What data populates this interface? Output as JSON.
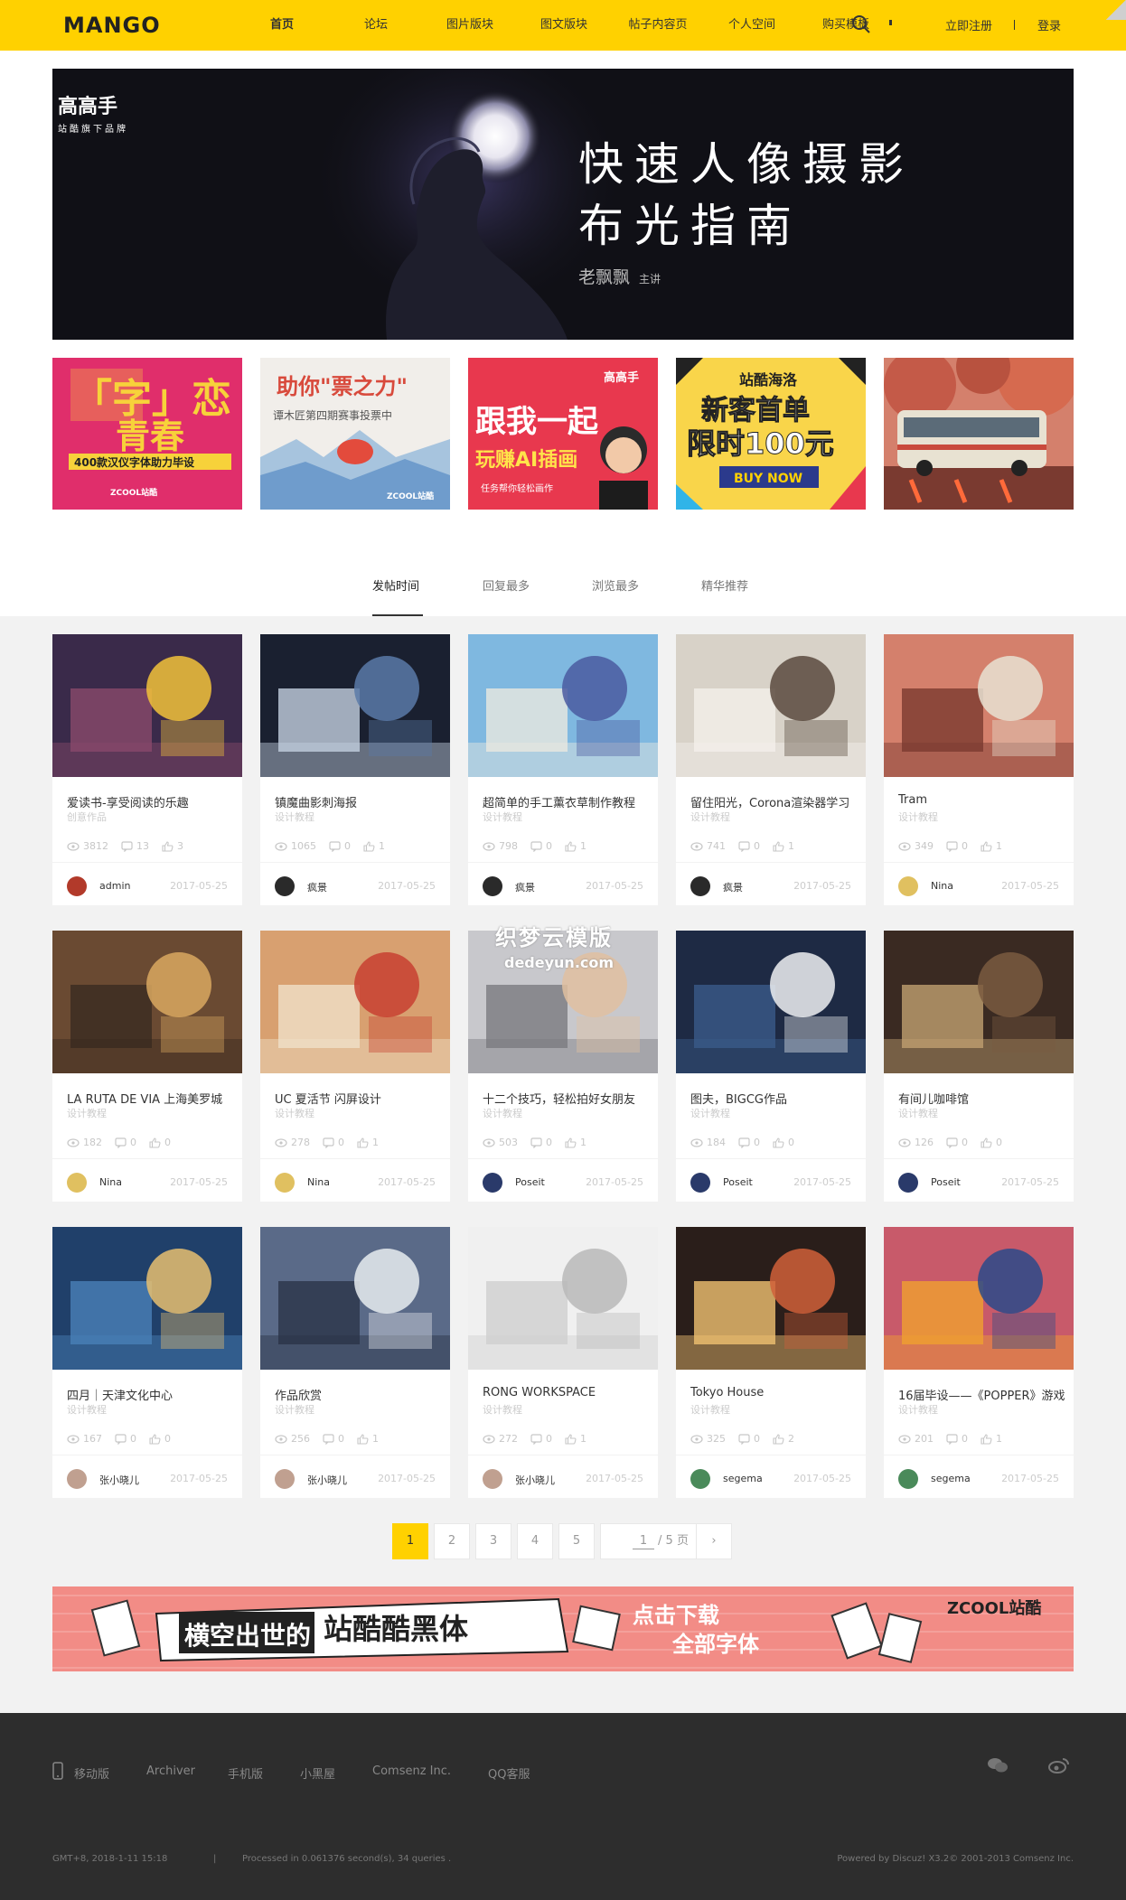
{
  "header": {
    "logo": "MANGO",
    "nav": [
      "首页",
      "论坛",
      "图片版块",
      "图文版块",
      "帖子内容页",
      "个人空间",
      "购买模板"
    ],
    "register": "立即注册",
    "login": "登录"
  },
  "hero": {
    "logo_big": "高高手",
    "logo_small": "站酷旗下品牌",
    "title_line1": "快速人像摄影",
    "title_line2": "布光指南",
    "author": "老飘飘",
    "author_role": "主讲"
  },
  "promos": [
    {
      "name": "promo-font-youth",
      "text1": "「字」恋",
      "text2": "青春",
      "text3": "400款汉仪字体助力毕设",
      "text4": "ZCOOL站酷"
    },
    {
      "name": "promo-vote",
      "text1": "助你\"票之力\"",
      "text2": "谭木匠第四期赛事投票中",
      "text3": "ZCOOL站酷"
    },
    {
      "name": "promo-ai",
      "text1": "高高手",
      "text2": "跟我一起",
      "text3": "玩赚AI插画",
      "text4": "任务帮你轻松画作"
    },
    {
      "name": "promo-shop",
      "text1": "站酷海洛",
      "text2": "新客首单",
      "text3": "限时100元",
      "text4": "BUY NOW"
    },
    {
      "name": "promo-bus",
      "text1": ""
    }
  ],
  "tabs": [
    "发帖时间",
    "回复最多",
    "浏览最多",
    "精华推荐"
  ],
  "cards": [
    {
      "title": "爱读书-享受阅读的乐趣",
      "cat": "创意作品",
      "views": "3812",
      "replies": "13",
      "likes": "3",
      "user": "admin",
      "date": "2017-05-25"
    },
    {
      "title": "镇魔曲影刺海报",
      "cat": "设计教程",
      "views": "1065",
      "replies": "0",
      "likes": "1",
      "user": "疯景",
      "date": "2017-05-25"
    },
    {
      "title": "超简单的手工薰衣草制作教程",
      "cat": "设计教程",
      "views": "798",
      "replies": "0",
      "likes": "1",
      "user": "疯景",
      "date": "2017-05-25"
    },
    {
      "title": "留住阳光，Corona渲染器学习",
      "cat": "设计教程",
      "views": "741",
      "replies": "0",
      "likes": "1",
      "user": "疯景",
      "date": "2017-05-25"
    },
    {
      "title": "Tram",
      "cat": "设计教程",
      "views": "349",
      "replies": "0",
      "likes": "1",
      "user": "Nina",
      "date": "2017-05-25"
    },
    {
      "title": "LA RUTA DE VIA 上海美罗城",
      "cat": "设计教程",
      "views": "182",
      "replies": "0",
      "likes": "0",
      "user": "Nina",
      "date": "2017-05-25"
    },
    {
      "title": "UC 夏活节 闪屏设计",
      "cat": "设计教程",
      "views": "278",
      "replies": "0",
      "likes": "1",
      "user": "Nina",
      "date": "2017-05-25"
    },
    {
      "title": "十二个技巧，轻松拍好女朋友",
      "cat": "设计教程",
      "views": "503",
      "replies": "0",
      "likes": "1",
      "user": "Poseit",
      "date": "2017-05-25"
    },
    {
      "title": "图夫，BIGCG作品",
      "cat": "设计教程",
      "views": "184",
      "replies": "0",
      "likes": "0",
      "user": "Poseit",
      "date": "2017-05-25"
    },
    {
      "title": "有间儿咖啡馆",
      "cat": "设计教程",
      "views": "126",
      "replies": "0",
      "likes": "0",
      "user": "Poseit",
      "date": "2017-05-25"
    },
    {
      "title": "四月｜天津文化中心",
      "cat": "设计教程",
      "views": "167",
      "replies": "0",
      "likes": "0",
      "user": "张小晓儿",
      "date": "2017-05-25"
    },
    {
      "title": "作品欣赏",
      "cat": "设计教程",
      "views": "256",
      "replies": "0",
      "likes": "1",
      "user": "张小晓儿",
      "date": "2017-05-25"
    },
    {
      "title": "RONG WORKSPACE",
      "cat": "设计教程",
      "views": "272",
      "replies": "0",
      "likes": "1",
      "user": "张小晓儿",
      "date": "2017-05-25"
    },
    {
      "title": "Tokyo House",
      "cat": "设计教程",
      "views": "325",
      "replies": "0",
      "likes": "2",
      "user": "segema",
      "date": "2017-05-25"
    },
    {
      "title": "16届毕设——《POPPER》游戏",
      "cat": "设计教程",
      "views": "201",
      "replies": "0",
      "likes": "1",
      "user": "segema",
      "date": "2017-05-25"
    }
  ],
  "watermark": {
    "line1": "织梦云模版",
    "line2": "dedeyun.com"
  },
  "pager": {
    "pages": [
      "1",
      "2",
      "3",
      "4",
      "5"
    ],
    "current": "1",
    "jump_value": "1",
    "jump_total": "/ 5 页",
    "next": "›"
  },
  "banner": {
    "text1": "横空出世的",
    "text2": "站酷酷黑体",
    "text3": "点击下载",
    "text4": "全部字体",
    "brand": "ZCOOL站酷"
  },
  "footer": {
    "links": [
      "移动版",
      "Archiver",
      "手机版",
      "小黑屋",
      "Comsenz Inc.",
      "QQ客服"
    ],
    "gmt": "GMT+8, 2018-1-11 15:18",
    "processed": "Processed in 0.061376 second(s), 34 queries .",
    "powered": "Powered by Discuz! X3.2© 2001-2013 Comsenz Inc."
  }
}
